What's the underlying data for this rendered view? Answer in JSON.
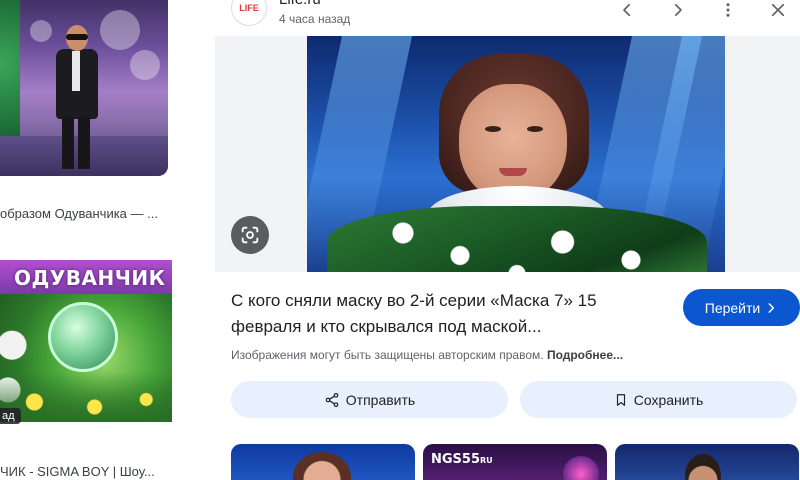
{
  "left_results": {
    "items": [
      {
        "caption": "образом Одуванчика — ..."
      },
      {
        "caption": "ЧИК - SIGMA BOY | Шоу...",
        "badge": "ад",
        "thumb_title": "ОДУВАНЧИК"
      }
    ]
  },
  "panel": {
    "source": {
      "logo_text": "LIFE",
      "name": "Life.ru",
      "time": "4 часа назад"
    },
    "nav": {
      "prev_icon": "chevron-left-icon",
      "next_icon": "chevron-right-icon",
      "more_icon": "more-vert-icon",
      "close_icon": "close-icon"
    },
    "image_overlay": {
      "lens_icon": "google-lens-icon"
    },
    "title": "С кого сняли маску во 2-й серии «Маска 7» 15 февраля и кто скрывался под маской...",
    "visit_button": {
      "label": "Перейти",
      "icon": "chevron-right-icon"
    },
    "copyright": {
      "text": "Изображения могут быть защищены авторским правом.",
      "link": "Подробнее..."
    },
    "actions": [
      {
        "label": "Отправить",
        "icon": "share-icon"
      },
      {
        "label": "Сохранить",
        "icon": "bookmark-icon"
      }
    ],
    "related": [
      {
        "logo": ""
      },
      {
        "logo": "NGS55",
        "logo_suffix": "RU"
      },
      {
        "logo": ""
      }
    ]
  },
  "colors": {
    "primary_button": "#0b57d0",
    "tonal_button": "#e8f0fe",
    "text_primary": "#202124",
    "text_secondary": "#5f6368"
  }
}
